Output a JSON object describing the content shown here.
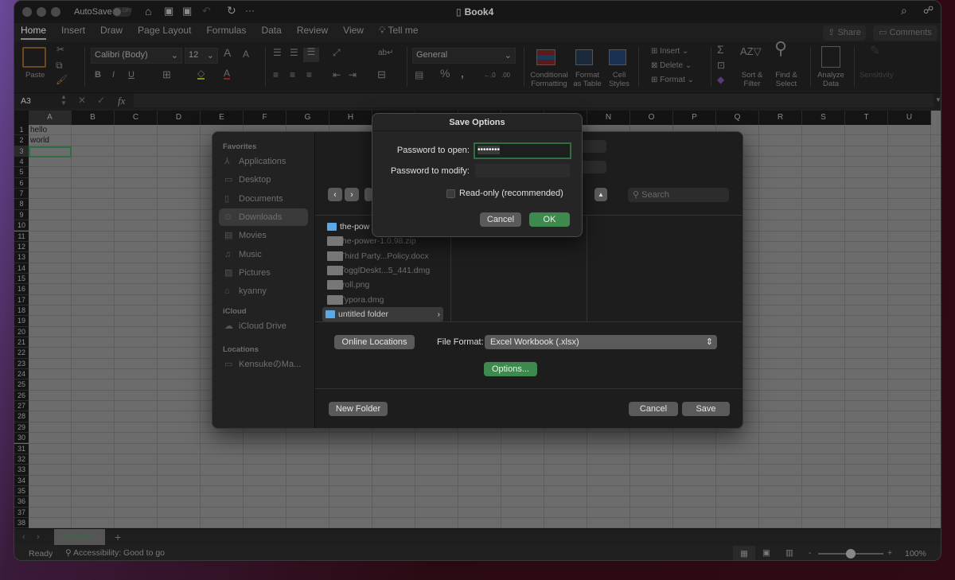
{
  "window": {
    "autosave_label": "AutoSave",
    "autosave_state": "OFF",
    "title": "Book4"
  },
  "tabs": [
    "Home",
    "Insert",
    "Draw",
    "Page Layout",
    "Formulas",
    "Data",
    "Review",
    "View",
    "Tell me"
  ],
  "toolbar": {
    "share": "Share",
    "comments": "Comments"
  },
  "ribbon": {
    "paste": "Paste",
    "font": "Calibri (Body)",
    "size": "12",
    "number_format": "General",
    "percent": "%",
    "conditional": [
      "Conditional",
      "Formatting"
    ],
    "format_table": [
      "Format",
      "as Table"
    ],
    "cell_styles": [
      "Cell",
      "Styles"
    ],
    "insert": "Insert",
    "delete": "Delete",
    "format": "Format",
    "sort": [
      "Sort &",
      "Filter"
    ],
    "find": [
      "Find &",
      "Select"
    ],
    "analyze": [
      "Analyze",
      "Data"
    ],
    "sensitivity": "Sensitivity"
  },
  "formula_bar": {
    "name_box": "A3",
    "fx": "fx",
    "value": ""
  },
  "grid": {
    "columns": [
      "A",
      "B",
      "C",
      "D",
      "E",
      "F",
      "G",
      "H",
      "I",
      "J",
      "K",
      "L",
      "M",
      "N",
      "O",
      "P",
      "Q",
      "R",
      "S",
      "T",
      "U"
    ],
    "row_count": 38,
    "cells": {
      "A1": "hello",
      "A2": "world"
    },
    "selected": "A3"
  },
  "sheets": {
    "tabs": [
      "Sheet1"
    ],
    "add": "+"
  },
  "status": {
    "ready": "Ready",
    "accessibility": "Accessibility: Good to go",
    "zoom": "100%",
    "zoom_fraction": 0.5
  },
  "save_dialog": {
    "sidebar": {
      "favorites_header": "Favorites",
      "favorites": [
        "Applications",
        "Desktop",
        "Documents",
        "Downloads",
        "Movies",
        "Music",
        "Pictures",
        "kyanny"
      ],
      "selected": "Downloads",
      "icloud_header": "iCloud",
      "icloud": [
        "iCloud Drive"
      ],
      "locations_header": "Locations",
      "locations": [
        "KensukeのMa..."
      ]
    },
    "search_placeholder": "Search",
    "files": [
      {
        "name": "the-pow",
        "type": "folder"
      },
      {
        "name": "the-power-1.0.98.zip",
        "type": "file"
      },
      {
        "name": "Third Party...Policy.docx",
        "type": "file"
      },
      {
        "name": "TogglDeskt...5_441.dmg",
        "type": "file"
      },
      {
        "name": "troll.png",
        "type": "file"
      },
      {
        "name": "Typora.dmg",
        "type": "file"
      },
      {
        "name": "untitled folder",
        "type": "folder"
      }
    ],
    "online_locations": "Online Locations",
    "file_format_label": "File Format:",
    "file_format": "Excel Workbook (.xlsx)",
    "options": "Options...",
    "new_folder": "New Folder",
    "cancel": "Cancel",
    "save": "Save"
  },
  "save_options": {
    "title": "Save Options",
    "password_open_label": "Password to open:",
    "password_open_value": "••••••••",
    "password_modify_label": "Password to modify:",
    "password_modify_value": "",
    "readonly_label": "Read-only (recommended)",
    "readonly_checked": false,
    "cancel": "Cancel",
    "ok": "OK"
  },
  "colors": {
    "accent_green": "#3e8a4e",
    "selection_border": "#2f6f3f"
  }
}
